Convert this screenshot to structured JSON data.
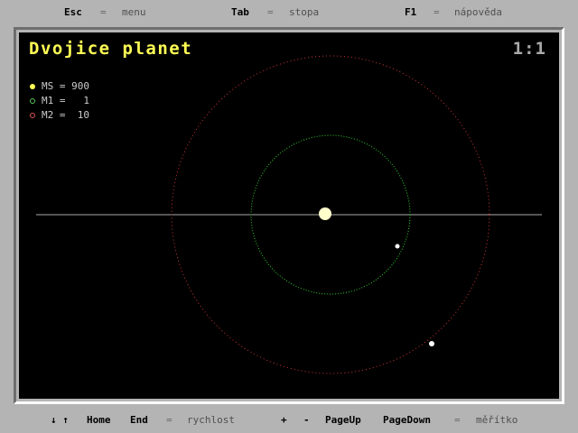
{
  "top_bar": {
    "esc_key": "Esc",
    "esc_eq": "=",
    "esc_action": "menu",
    "tab_key": "Tab",
    "tab_eq": "=",
    "tab_action": "stopa",
    "f1_key": "F1",
    "f1_eq": "=",
    "f1_action": "nápověda"
  },
  "bottom_bar": {
    "arrows_label": "↓ ↑",
    "home_key": "Home",
    "end_key": "End",
    "speed_eq": "=",
    "speed_action": "rychlost",
    "plus_key": "+",
    "minus_key": "-",
    "pageup_key": "PageUp",
    "pagedown_key": "PageDown",
    "scale_eq": "=",
    "scale_action": "měřítko"
  },
  "screen": {
    "title": "Dvojice planet",
    "scale": "1:1"
  },
  "legend": [
    {
      "label": "MS = 900",
      "color": "#ffff55"
    },
    {
      "label": "M1 =   1",
      "color": "#55cc55"
    },
    {
      "label": "M2 =  10",
      "color": "#dd5555"
    }
  ],
  "colors": {
    "background": "#000000",
    "sun": "#ffffaa",
    "orbit_inner": "#33cc33",
    "orbit_outer": "#cc3333",
    "planet": "#ffffff",
    "axis_line": "#aaaaaa"
  }
}
